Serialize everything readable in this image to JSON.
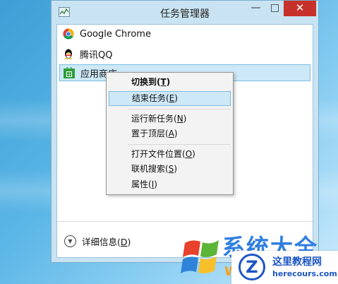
{
  "window": {
    "title": "任务管理器",
    "buttons": {
      "minimize": "—",
      "maximize": "□",
      "close": "✕"
    }
  },
  "apps": [
    {
      "label": "Google Chrome",
      "icon": "chrome-icon"
    },
    {
      "label": "腾讯QQ",
      "icon": "qq-penguin-icon"
    },
    {
      "label": "应用商店",
      "icon": "store-icon",
      "selected": true
    }
  ],
  "context_menu": {
    "items": [
      {
        "label": "切换到(",
        "accel": "T",
        "suffix": ")",
        "bold": true
      },
      {
        "label": "结束任务(",
        "accel": "E",
        "suffix": ")",
        "hover": true
      },
      {
        "label": "运行新任务(",
        "accel": "N",
        "suffix": ")"
      },
      {
        "label": "置于顶层(",
        "accel": "A",
        "suffix": ")"
      },
      {
        "label": "打开文件位置(",
        "accel": "O",
        "suffix": ")"
      },
      {
        "label": "联机搜索(",
        "accel": "S",
        "suffix": ")"
      },
      {
        "label": "属性(",
        "accel": "I",
        "suffix": ")"
      }
    ]
  },
  "footer": {
    "details_label": "详细信息(",
    "details_accel": "D",
    "details_suffix": ")"
  },
  "watermark": {
    "brand": "系统大全",
    "brand_letter": "W",
    "site_title": "这里教程网",
    "site_url": "herecours.com",
    "badge_letter": "Z"
  },
  "colors": {
    "close_button": "#c7312b",
    "selection": "#cde8f7",
    "watermark_blue": "#1d55c4"
  }
}
